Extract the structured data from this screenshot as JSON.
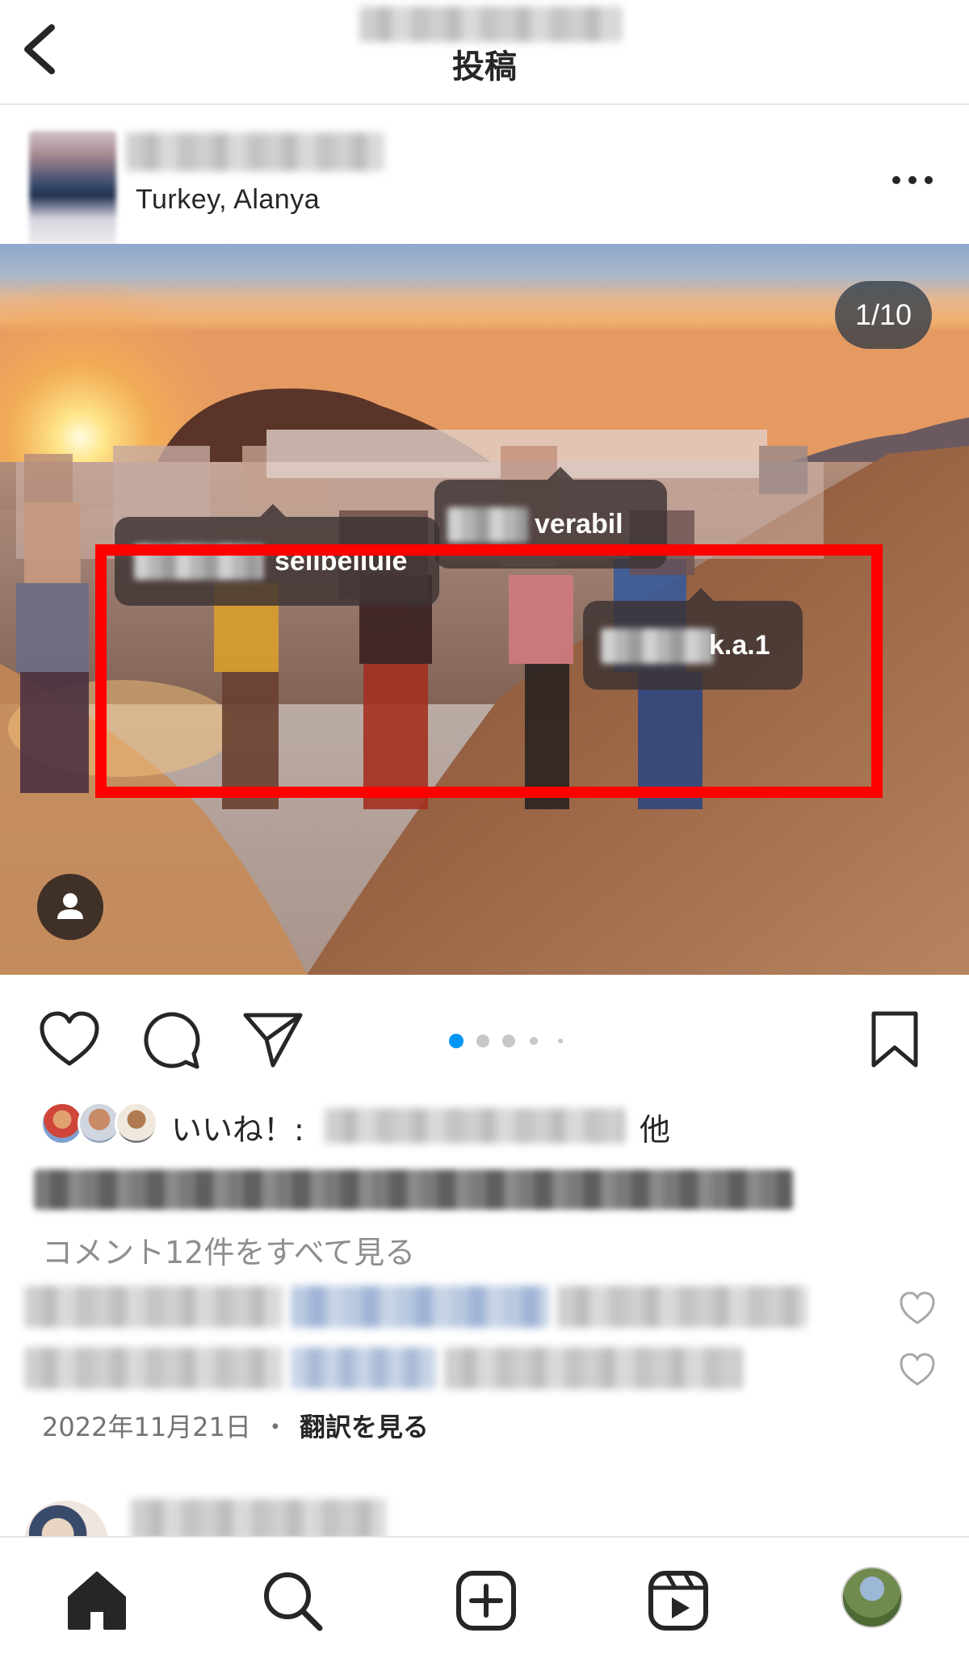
{
  "header": {
    "title": "投稿"
  },
  "post": {
    "location": "Turkey, Alanya",
    "image_counter": "1/10",
    "carousel": {
      "total_dots": 5,
      "active_index": 0
    },
    "tags": [
      {
        "visible_text": "selibellule"
      },
      {
        "visible_text": "verabil"
      },
      {
        "visible_text": "k.a.1"
      }
    ]
  },
  "likes": {
    "label": "いいね！:",
    "suffix": "他"
  },
  "comments": {
    "view_all": "コメント12件をすべて見る"
  },
  "date": {
    "text": "2022年11月21日",
    "separator": "・",
    "translate": "翻訳を見る"
  },
  "colors": {
    "highlight_box": "#ff0000",
    "active_dot": "#0095f6",
    "text_primary": "#262626",
    "text_secondary": "#8e8e8e"
  },
  "icons": {
    "back": "chevron-left-icon",
    "more": "more-horizontal-icon",
    "like": "heart-icon",
    "comment": "comment-icon",
    "share": "send-icon",
    "save": "bookmark-icon",
    "tagged_users": "person-icon",
    "nav": [
      "home-icon",
      "search-icon",
      "create-icon",
      "reels-icon",
      "profile-avatar"
    ]
  }
}
